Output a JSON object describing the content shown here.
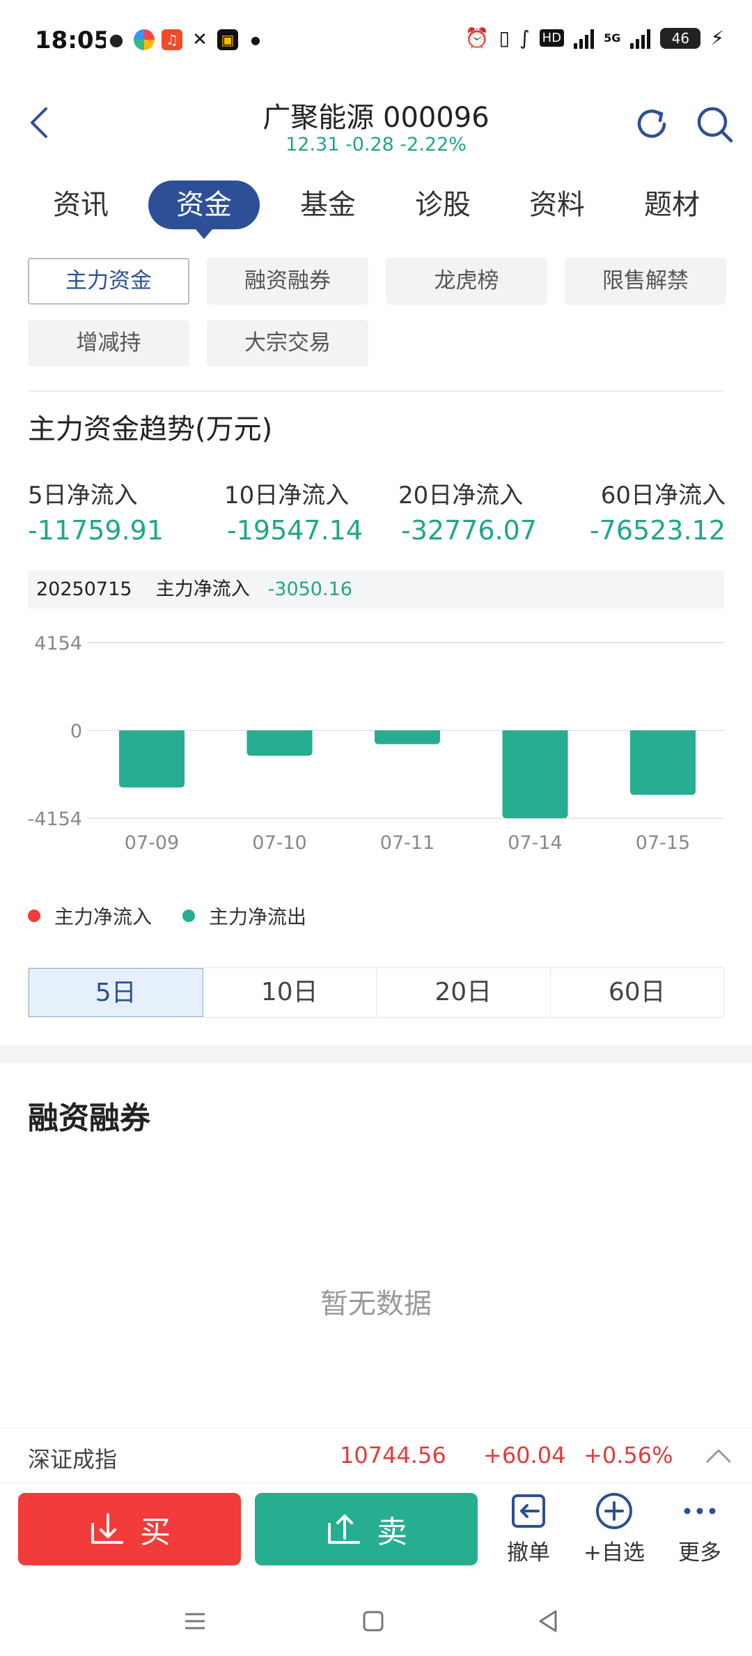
{
  "status_bar": {
    "time": "18:05",
    "hd_label": "HD",
    "network_5g": "5G",
    "battery": "46"
  },
  "header": {
    "title": "广聚能源 000096",
    "quote": "12.31 -0.28 -2.22%"
  },
  "tabs": [
    "资讯",
    "资金",
    "基金",
    "诊股",
    "资料",
    "题材"
  ],
  "active_tab": "资金",
  "sub_tabs": [
    "主力资金",
    "融资融券",
    "龙虎榜",
    "限售解禁",
    "增减持",
    "大宗交易"
  ],
  "active_sub_tab": "主力资金",
  "main_fund": {
    "title": "主力资金趋势(万元)",
    "stats": [
      {
        "label": "5日净流入",
        "value": "-11759.91"
      },
      {
        "label": "10日净流入",
        "value": "-19547.14"
      },
      {
        "label": "20日净流入",
        "value": "-32776.07"
      },
      {
        "label": "60日净流入",
        "value": "-76523.12"
      }
    ],
    "selected": {
      "date": "20250715",
      "label": "主力净流入",
      "value": "-3050.16"
    }
  },
  "chart_data": {
    "type": "bar",
    "categories": [
      "07-09",
      "07-10",
      "07-11",
      "07-14",
      "07-15"
    ],
    "values": [
      -2700,
      -1200,
      -650,
      -4154,
      -3050.16
    ],
    "y_ticks": [
      "4154",
      "0",
      "-4154"
    ],
    "ylim": [
      -4154,
      4154
    ],
    "grid": true,
    "legend": [
      {
        "label": "主力净流入",
        "color": "#f23b3b"
      },
      {
        "label": "主力净流出",
        "color": "#27ad8f"
      }
    ],
    "bar_color": "#27ad8f"
  },
  "period_tabs": [
    "5日",
    "10日",
    "20日",
    "60日"
  ],
  "active_period": "5日",
  "margin": {
    "title": "融资融券",
    "empty_text": "暂无数据"
  },
  "index_bar": {
    "name": "深证成指",
    "value": "10744.56",
    "change": "+60.04",
    "percent": "+0.56%"
  },
  "actions": {
    "buy": "买",
    "sell": "卖",
    "cancel": "撤单",
    "watchlist": "+自选",
    "more": "更多"
  },
  "colors": {
    "accent": "#2d4f96",
    "down": "#1fa68a",
    "up": "#e23b3b"
  }
}
